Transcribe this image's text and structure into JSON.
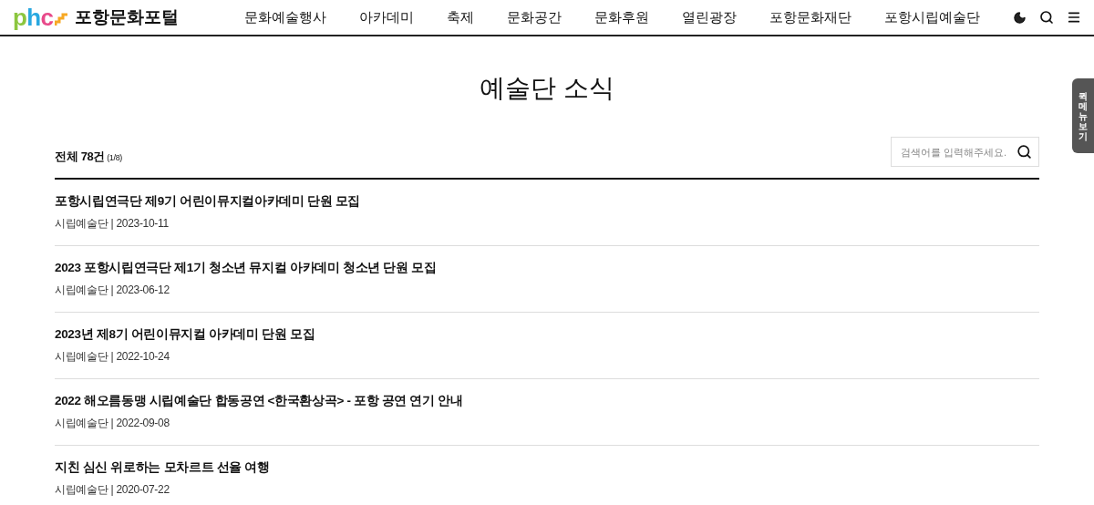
{
  "header": {
    "logo_letters": [
      {
        "text": "p",
        "color": "#8cc63f"
      },
      {
        "text": "h",
        "color": "#29a8e0"
      },
      {
        "text": "c",
        "color": "#e84a8a"
      }
    ],
    "site_name": "포항문화포털",
    "nav": [
      "문화예술행사",
      "아카데미",
      "축제",
      "문화공간",
      "문화후원",
      "열린광장",
      "포항문화재단",
      "포항시립예술단"
    ]
  },
  "page_title": "예술단 소식",
  "total": {
    "label": "전체 78건",
    "page": "(1/8)"
  },
  "search": {
    "placeholder": "검색어를 입력해주세요."
  },
  "quick_menu": "퀵메뉴보기",
  "posts": [
    {
      "title": "포항시립연극단 제9기 어린이뮤지컬아카데미 단원 모집",
      "meta": "시립예술단 | 2023-10-11"
    },
    {
      "title": "2023 포항시립연극단 제1기 청소년 뮤지컬 아카데미 청소년 단원 모집",
      "meta": "시립예술단 | 2023-06-12"
    },
    {
      "title": "2023년 제8기 어린이뮤지컬 아카데미 단원 모집",
      "meta": "시립예술단 | 2022-10-24"
    },
    {
      "title": "2022 해오름동맹 시립예술단 합동공연 <한국환상곡> - 포항 공연 연기 안내",
      "meta": "시립예술단 | 2022-09-08"
    },
    {
      "title": "지친 심신 위로하는 모차르트 선율 여행",
      "meta": "시립예술단 | 2020-07-22"
    }
  ]
}
